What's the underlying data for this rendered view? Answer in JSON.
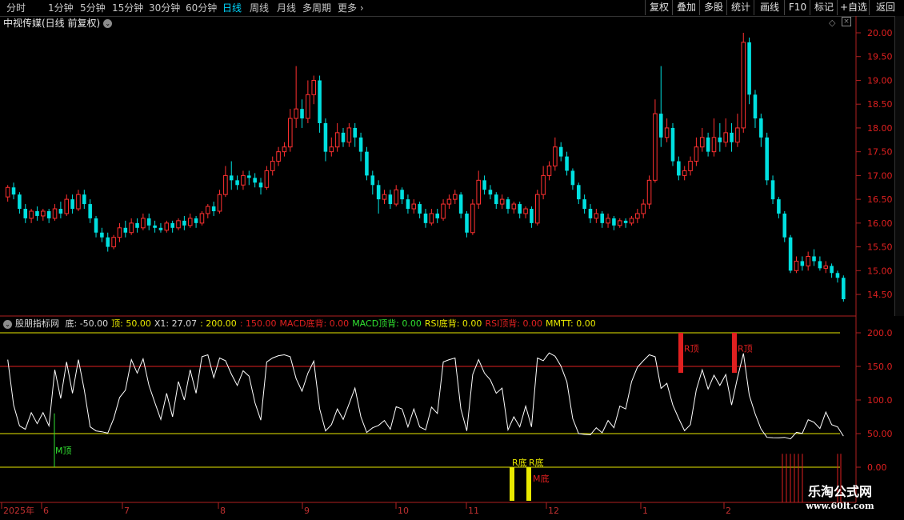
{
  "toolbar": {
    "periods": [
      "分时",
      "1分钟",
      "5分钟",
      "15分钟",
      "30分钟",
      "60分钟",
      "日线",
      "周线",
      "月线",
      "多周期",
      "更多"
    ],
    "active_period": "日线",
    "right_buttons": [
      "复权",
      "叠加",
      "多股",
      "统计",
      "画线",
      "F10",
      "标记",
      "+自选",
      "返回"
    ]
  },
  "chart_title": "中视传媒(日线 前复权)",
  "price_axis": [
    "20.00",
    "19.50",
    "19.00",
    "18.50",
    "18.00",
    "17.50",
    "17.00",
    "16.50",
    "16.00",
    "15.50",
    "15.00",
    "14.50"
  ],
  "indicator": {
    "name": "股朋指标网",
    "legend": [
      {
        "label": "底: -50.00",
        "color": "#d8d8d8"
      },
      {
        "label": "顶: 50.00",
        "color": "#e8e800"
      },
      {
        "label": "X1: 27.07",
        "color": "#d8d8d8"
      },
      {
        "label": ": 200.00",
        "color": "#e8e800"
      },
      {
        "label": ": 150.00",
        "color": "#e02020"
      },
      {
        "label": "MACD底背: 0.00",
        "color": "#e02020"
      },
      {
        "label": "MACD顶背: 0.00",
        "color": "#30e030"
      },
      {
        "label": "RSI底背: 0.00",
        "color": "#e8e800"
      },
      {
        "label": "RSI顶背: 0.00",
        "color": "#e02020"
      },
      {
        "label": "MMTT: 0.00",
        "color": "#e8e800"
      }
    ],
    "axis": [
      "200.0",
      "150.0",
      "100.0",
      "50.00",
      "0.00"
    ],
    "markers": {
      "m_top": "M顶",
      "r_top": "R顶",
      "r_bottom": "R底",
      "m_bottom": "M底"
    }
  },
  "date_axis": [
    "2025年",
    "6",
    "7",
    "8",
    "9",
    "10",
    "11",
    "12",
    "1",
    "2"
  ],
  "watermark": {
    "title": "乐淘公式网",
    "url": "www.60lt.com"
  },
  "colors": {
    "up": "#ff3030",
    "down": "#00e0e0",
    "active": "#00d8ff",
    "line": "#ffffff"
  },
  "chart_data": {
    "type": "candlestick",
    "title": "中视传媒(日线 前复权)",
    "ylim": [
      14.3,
      20.1
    ],
    "candles": [
      [
        16.55,
        16.75,
        16.45,
        16.8
      ],
      [
        16.75,
        16.6,
        16.5,
        16.85
      ],
      [
        16.6,
        16.3,
        16.2,
        16.65
      ],
      [
        16.3,
        16.1,
        16.0,
        16.4
      ],
      [
        16.1,
        16.25,
        16.0,
        16.3
      ],
      [
        16.25,
        16.15,
        16.05,
        16.35
      ],
      [
        16.15,
        16.25,
        16.05,
        16.3
      ],
      [
        16.25,
        16.1,
        16.0,
        16.3
      ],
      [
        16.1,
        16.3,
        16.05,
        16.4
      ],
      [
        16.3,
        16.2,
        16.1,
        16.45
      ],
      [
        16.2,
        16.5,
        16.15,
        16.6
      ],
      [
        16.5,
        16.3,
        16.2,
        16.6
      ],
      [
        16.3,
        16.6,
        16.25,
        16.7
      ],
      [
        16.6,
        16.4,
        16.3,
        16.7
      ],
      [
        16.4,
        16.1,
        16.0,
        16.5
      ],
      [
        16.1,
        15.8,
        15.7,
        16.15
      ],
      [
        15.8,
        15.7,
        15.6,
        15.9
      ],
      [
        15.7,
        15.5,
        15.4,
        15.8
      ],
      [
        15.5,
        15.7,
        15.45,
        15.75
      ],
      [
        15.7,
        15.9,
        15.6,
        16.0
      ],
      [
        15.9,
        15.8,
        15.7,
        16.05
      ],
      [
        15.8,
        16.0,
        15.75,
        16.1
      ],
      [
        16.0,
        15.9,
        15.8,
        16.1
      ],
      [
        15.9,
        16.1,
        15.85,
        16.2
      ],
      [
        16.1,
        15.95,
        15.85,
        16.2
      ],
      [
        15.95,
        15.9,
        15.8,
        16.05
      ],
      [
        15.9,
        15.85,
        15.8,
        16.0
      ],
      [
        15.85,
        16.0,
        15.8,
        16.05
      ],
      [
        16.0,
        15.9,
        15.8,
        16.05
      ],
      [
        15.9,
        16.05,
        15.85,
        16.1
      ],
      [
        16.05,
        15.95,
        15.85,
        16.15
      ],
      [
        15.95,
        16.1,
        15.9,
        16.2
      ],
      [
        16.1,
        16.0,
        15.9,
        16.15
      ],
      [
        16.0,
        16.2,
        15.95,
        16.25
      ],
      [
        16.2,
        16.35,
        16.1,
        16.4
      ],
      [
        16.35,
        16.25,
        16.15,
        16.45
      ],
      [
        16.25,
        16.6,
        16.2,
        16.7
      ],
      [
        16.6,
        17.0,
        16.55,
        17.2
      ],
      [
        17.0,
        16.9,
        16.7,
        17.3
      ],
      [
        16.9,
        16.8,
        16.7,
        17.0
      ],
      [
        16.8,
        17.0,
        16.7,
        17.1
      ],
      [
        17.0,
        16.95,
        16.8,
        17.1
      ],
      [
        16.95,
        16.85,
        16.75,
        17.05
      ],
      [
        16.85,
        16.75,
        16.6,
        16.95
      ],
      [
        16.75,
        17.1,
        16.7,
        17.2
      ],
      [
        17.1,
        17.3,
        17.0,
        17.4
      ],
      [
        17.3,
        17.5,
        17.2,
        17.6
      ],
      [
        17.5,
        17.6,
        17.4,
        17.7
      ],
      [
        17.6,
        18.2,
        17.5,
        18.4
      ],
      [
        18.2,
        18.4,
        18.0,
        19.3
      ],
      [
        18.4,
        18.2,
        18.0,
        18.6
      ],
      [
        18.2,
        18.7,
        18.1,
        19.0
      ],
      [
        18.7,
        19.0,
        18.5,
        19.1
      ],
      [
        19.0,
        18.1,
        17.9,
        19.1
      ],
      [
        18.1,
        17.5,
        17.3,
        18.2
      ],
      [
        17.5,
        17.6,
        17.4,
        17.8
      ],
      [
        17.6,
        17.9,
        17.5,
        18.1
      ],
      [
        17.9,
        17.7,
        17.6,
        18.0
      ],
      [
        17.7,
        18.0,
        17.6,
        18.1
      ],
      [
        18.0,
        17.8,
        17.6,
        18.1
      ],
      [
        17.8,
        17.5,
        17.3,
        17.9
      ],
      [
        17.5,
        17.0,
        16.9,
        17.6
      ],
      [
        17.0,
        16.8,
        16.6,
        17.1
      ],
      [
        16.8,
        16.5,
        16.2,
        16.9
      ],
      [
        16.5,
        16.6,
        16.4,
        16.7
      ],
      [
        16.6,
        16.4,
        16.3,
        16.7
      ],
      [
        16.4,
        16.7,
        16.35,
        16.8
      ],
      [
        16.7,
        16.5,
        16.4,
        16.75
      ],
      [
        16.5,
        16.3,
        16.2,
        16.6
      ],
      [
        16.3,
        16.4,
        16.2,
        16.5
      ],
      [
        16.4,
        16.2,
        16.1,
        16.45
      ],
      [
        16.2,
        16.0,
        15.9,
        16.3
      ],
      [
        16.0,
        16.2,
        15.95,
        16.3
      ],
      [
        16.2,
        16.1,
        16.0,
        16.3
      ],
      [
        16.1,
        16.4,
        16.05,
        16.5
      ],
      [
        16.4,
        16.5,
        16.3,
        16.6
      ],
      [
        16.5,
        16.6,
        16.4,
        16.7
      ],
      [
        16.6,
        16.2,
        16.1,
        16.65
      ],
      [
        16.2,
        15.8,
        15.7,
        16.25
      ],
      [
        15.8,
        16.4,
        15.75,
        16.5
      ],
      [
        16.4,
        16.9,
        16.3,
        17.1
      ],
      [
        16.9,
        16.7,
        16.6,
        17.0
      ],
      [
        16.7,
        16.6,
        16.5,
        16.8
      ],
      [
        16.6,
        16.4,
        16.3,
        16.65
      ],
      [
        16.4,
        16.5,
        16.3,
        16.6
      ],
      [
        16.5,
        16.3,
        16.2,
        16.55
      ],
      [
        16.3,
        16.4,
        16.2,
        16.45
      ],
      [
        16.4,
        16.2,
        16.1,
        16.45
      ],
      [
        16.2,
        16.3,
        16.1,
        16.35
      ],
      [
        16.3,
        16.0,
        15.9,
        16.35
      ],
      [
        16.0,
        16.6,
        15.95,
        16.7
      ],
      [
        16.6,
        17.0,
        16.5,
        17.2
      ],
      [
        17.0,
        17.2,
        16.9,
        17.3
      ],
      [
        17.2,
        17.6,
        17.1,
        17.8
      ],
      [
        17.6,
        17.4,
        17.3,
        17.7
      ],
      [
        17.4,
        17.1,
        17.0,
        17.5
      ],
      [
        17.1,
        16.8,
        16.7,
        17.15
      ],
      [
        16.8,
        16.5,
        16.4,
        16.85
      ],
      [
        16.5,
        16.3,
        16.2,
        16.6
      ],
      [
        16.3,
        16.1,
        16.0,
        16.4
      ],
      [
        16.1,
        16.2,
        16.0,
        16.3
      ],
      [
        16.2,
        16.0,
        15.9,
        16.25
      ],
      [
        16.0,
        16.1,
        15.9,
        16.2
      ],
      [
        16.1,
        15.95,
        15.85,
        16.15
      ],
      [
        15.95,
        16.05,
        15.9,
        16.1
      ],
      [
        16.05,
        16.0,
        15.9,
        16.1
      ],
      [
        16.0,
        16.1,
        15.95,
        16.15
      ],
      [
        16.1,
        16.2,
        16.0,
        16.3
      ],
      [
        16.2,
        16.4,
        16.1,
        16.5
      ],
      [
        16.4,
        16.9,
        16.3,
        17.0
      ],
      [
        16.9,
        18.3,
        16.85,
        18.6
      ],
      [
        18.3,
        17.8,
        17.6,
        19.3
      ],
      [
        17.8,
        18.0,
        17.7,
        18.2
      ],
      [
        18.0,
        17.3,
        17.2,
        18.1
      ],
      [
        17.3,
        17.0,
        16.9,
        17.4
      ],
      [
        17.0,
        17.1,
        16.9,
        17.2
      ],
      [
        17.1,
        17.3,
        17.0,
        17.4
      ],
      [
        17.3,
        17.6,
        17.2,
        17.8
      ],
      [
        17.6,
        17.8,
        17.5,
        18.0
      ],
      [
        17.8,
        17.5,
        17.4,
        17.9
      ],
      [
        17.5,
        17.8,
        17.4,
        18.2
      ],
      [
        17.8,
        17.7,
        17.5,
        18.1
      ],
      [
        17.7,
        17.9,
        17.6,
        18.2
      ],
      [
        17.9,
        17.7,
        17.5,
        18.1
      ],
      [
        17.7,
        18.0,
        17.6,
        18.3
      ],
      [
        18.0,
        19.8,
        17.9,
        20.0
      ],
      [
        19.8,
        18.7,
        18.5,
        19.9
      ],
      [
        18.7,
        18.2,
        18.0,
        18.8
      ],
      [
        18.2,
        17.8,
        17.6,
        18.3
      ],
      [
        17.8,
        16.9,
        16.8,
        17.9
      ],
      [
        16.9,
        16.5,
        16.4,
        17.0
      ],
      [
        16.5,
        16.2,
        16.1,
        16.55
      ],
      [
        16.2,
        15.7,
        15.6,
        16.25
      ],
      [
        15.7,
        15.0,
        14.95,
        15.75
      ],
      [
        15.0,
        15.2,
        14.95,
        15.3
      ],
      [
        15.2,
        15.1,
        15.0,
        15.3
      ],
      [
        15.1,
        15.3,
        15.0,
        15.4
      ],
      [
        15.3,
        15.2,
        15.1,
        15.45
      ],
      [
        15.2,
        15.05,
        15.0,
        15.3
      ],
      [
        15.05,
        15.1,
        14.95,
        15.2
      ],
      [
        15.1,
        14.95,
        14.85,
        15.15
      ],
      [
        14.95,
        14.85,
        14.75,
        15.0
      ],
      [
        14.85,
        14.4,
        14.35,
        14.9
      ]
    ]
  }
}
